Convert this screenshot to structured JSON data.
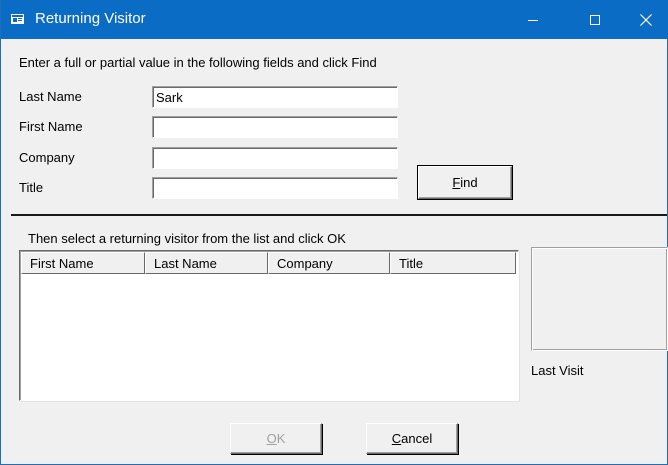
{
  "window": {
    "title": "Returning Visitor",
    "icon": "app-window-icon",
    "controls": {
      "minimize_icon": "minimize-icon",
      "maximize_icon": "maximize-icon",
      "close_icon": "close-icon"
    }
  },
  "colors": {
    "titlebar": "#0a6cc4",
    "dialog_bg": "#f0f0f0",
    "disabled_text": "#a0a0a0"
  },
  "search": {
    "instructions": "Enter a full or partial value in the following fields and click Find",
    "fields": [
      {
        "label": "Last Name",
        "value": "Sark",
        "placeholder": ""
      },
      {
        "label": "First Name",
        "value": "",
        "placeholder": ""
      },
      {
        "label": "Company",
        "value": "",
        "placeholder": ""
      },
      {
        "label": "Title",
        "value": "",
        "placeholder": ""
      }
    ],
    "find_button": {
      "accel": "F",
      "rest": "ind"
    }
  },
  "results": {
    "instructions": "Then select a returning visitor from the list and click OK",
    "columns": [
      "First Name",
      "Last Name",
      "Company",
      "Title"
    ],
    "rows": [],
    "last_visit_label": "Last Visit"
  },
  "footer": {
    "ok_button": {
      "accel": "O",
      "rest": "K",
      "enabled": false
    },
    "cancel_button": {
      "accel": "C",
      "rest": "ancel",
      "enabled": true
    }
  }
}
